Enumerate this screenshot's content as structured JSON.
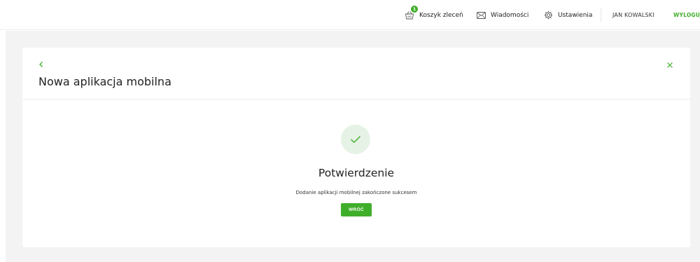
{
  "header": {
    "cart": {
      "label": "Koszyk zleceń",
      "badge_count": "1",
      "icon": "basket-icon"
    },
    "messages": {
      "label": "Wiadomości",
      "icon": "envelope-icon"
    },
    "settings": {
      "label": "Ustawienia",
      "icon": "gear-icon"
    },
    "user_name": "JAN KOWALSKI",
    "logout_label": "WYLOGUJ"
  },
  "card": {
    "title": "Nowa aplikacja mobilna",
    "back_icon": "chevron-left-icon",
    "close_icon": "close-icon",
    "success_icon": "checkmark-icon",
    "confirmation_title": "Potwierdzenie",
    "confirmation_message": "Dodanie aplikacji mobilnej zakończone sukcesem",
    "back_button_label": "WRÓĆ"
  },
  "colors": {
    "accent": "#3fae2a",
    "page_background": "#f3f3f3",
    "success_circle": "#e5f2e5"
  }
}
